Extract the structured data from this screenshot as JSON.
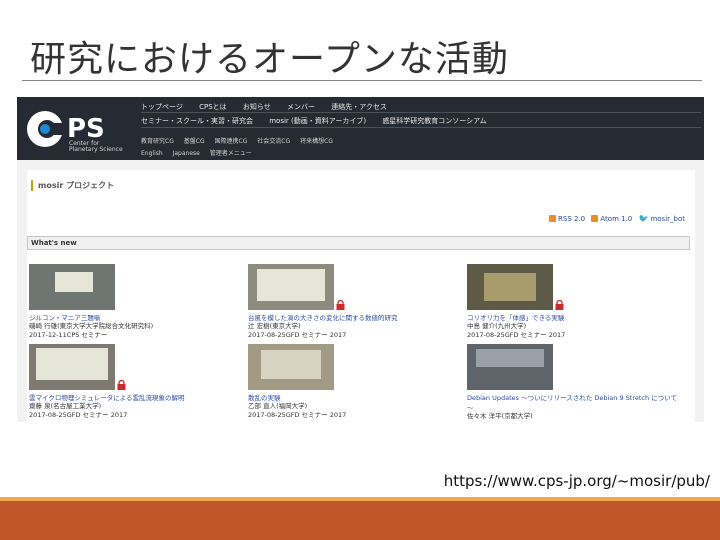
{
  "slide": {
    "title": "研究におけるオープンな活動",
    "url": "https://www.cps-jp.org/~mosir/pub/"
  },
  "site": {
    "logo_text": "PS",
    "logo_sub1": "Center for",
    "logo_sub2": "Planetary Science",
    "nav_row1": [
      "トップページ",
      "CPSとは",
      "お知らせ",
      "メンバー",
      "連絡先・アクセス"
    ],
    "nav_row2": [
      "セミナー・スクール・実習・研究会",
      "mosir (動画・資料アーカイブ)",
      "惑星科学研究教育コンソーシアム"
    ],
    "nav_row3": [
      "教育研究CG",
      "基盤CG",
      "国際連携CG",
      "社会交流CG",
      "将来構想CG"
    ],
    "nav_row4": [
      "English",
      "Japanese",
      "管理者メニュー"
    ]
  },
  "page": {
    "project_title": "mosir プロジェクト",
    "feeds": [
      "RSS 2.0",
      "Atom 1.0",
      "mosir_bot"
    ],
    "section_title": "What's new"
  },
  "items": [
    {
      "title": "ジルコン・マニア三題噺",
      "author": "磯崎 行雄(東京大学大学院総合文化研究科)",
      "date": "2017-12-11CPS セミナー",
      "locked": false
    },
    {
      "title": "台風を模した渦の大きさの変化に関する数値的研究",
      "author": "辻 宏樹(東京大学)",
      "date": "2017-08-25GFD セミナー 2017",
      "locked": true
    },
    {
      "title": "コリオリ力を「体感」できる実験",
      "author": "中島 健介(九州大学)",
      "date": "2017-08-25GFD セミナー 2017",
      "locked": true
    },
    {
      "title": "雲マイクロ物理シミュレータによる雲乱流現象の解明",
      "author": "齋藤 泉(名古屋工業大学)",
      "date": "2017-08-25GFD セミナー 2017",
      "locked": true
    },
    {
      "title": "散乱の実験",
      "author": "乙部 直人(福岡大学)",
      "date": "2017-08-25GFD セミナー 2017",
      "locked": false
    },
    {
      "title": "Debian Updates ～ついにリリースされた Debian 9 Stretch について～",
      "author": "佐々木 洋平(京都大学)",
      "date": "",
      "locked": false
    }
  ],
  "colors": {
    "header_bg": "#262b33",
    "link": "#2b4aa0",
    "accent_orange": "#f0a84a",
    "accent_rust": "#c0562a",
    "lock": "#d0282c"
  }
}
